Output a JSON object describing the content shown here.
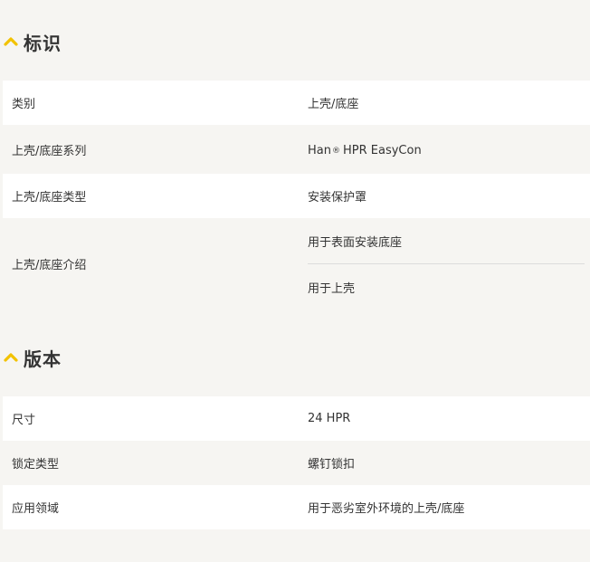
{
  "accent_color": "#f2c200",
  "sections": [
    {
      "icon": "chevron-up-icon",
      "title": "标识",
      "rows": [
        {
          "label": "类别",
          "value": "上壳/底座"
        },
        {
          "label": "上壳/底座系列",
          "value_prefix": "Han",
          "value_symbol": "®",
          "value_suffix": "HPR EasyCon"
        },
        {
          "label": "上壳/底座类型",
          "value": "安装保护罩"
        },
        {
          "label": "上壳/底座介绍",
          "values": [
            "用于表面安装底座",
            "用于上壳"
          ]
        }
      ]
    },
    {
      "icon": "chevron-up-icon",
      "title": "版本",
      "rows": [
        {
          "label": "尺寸",
          "value": "24 HPR"
        },
        {
          "label": "锁定类型",
          "value": "螺钉锁扣"
        },
        {
          "label": "应用领域",
          "value": "用于恶劣室外环境的上壳/底座"
        }
      ]
    }
  ]
}
